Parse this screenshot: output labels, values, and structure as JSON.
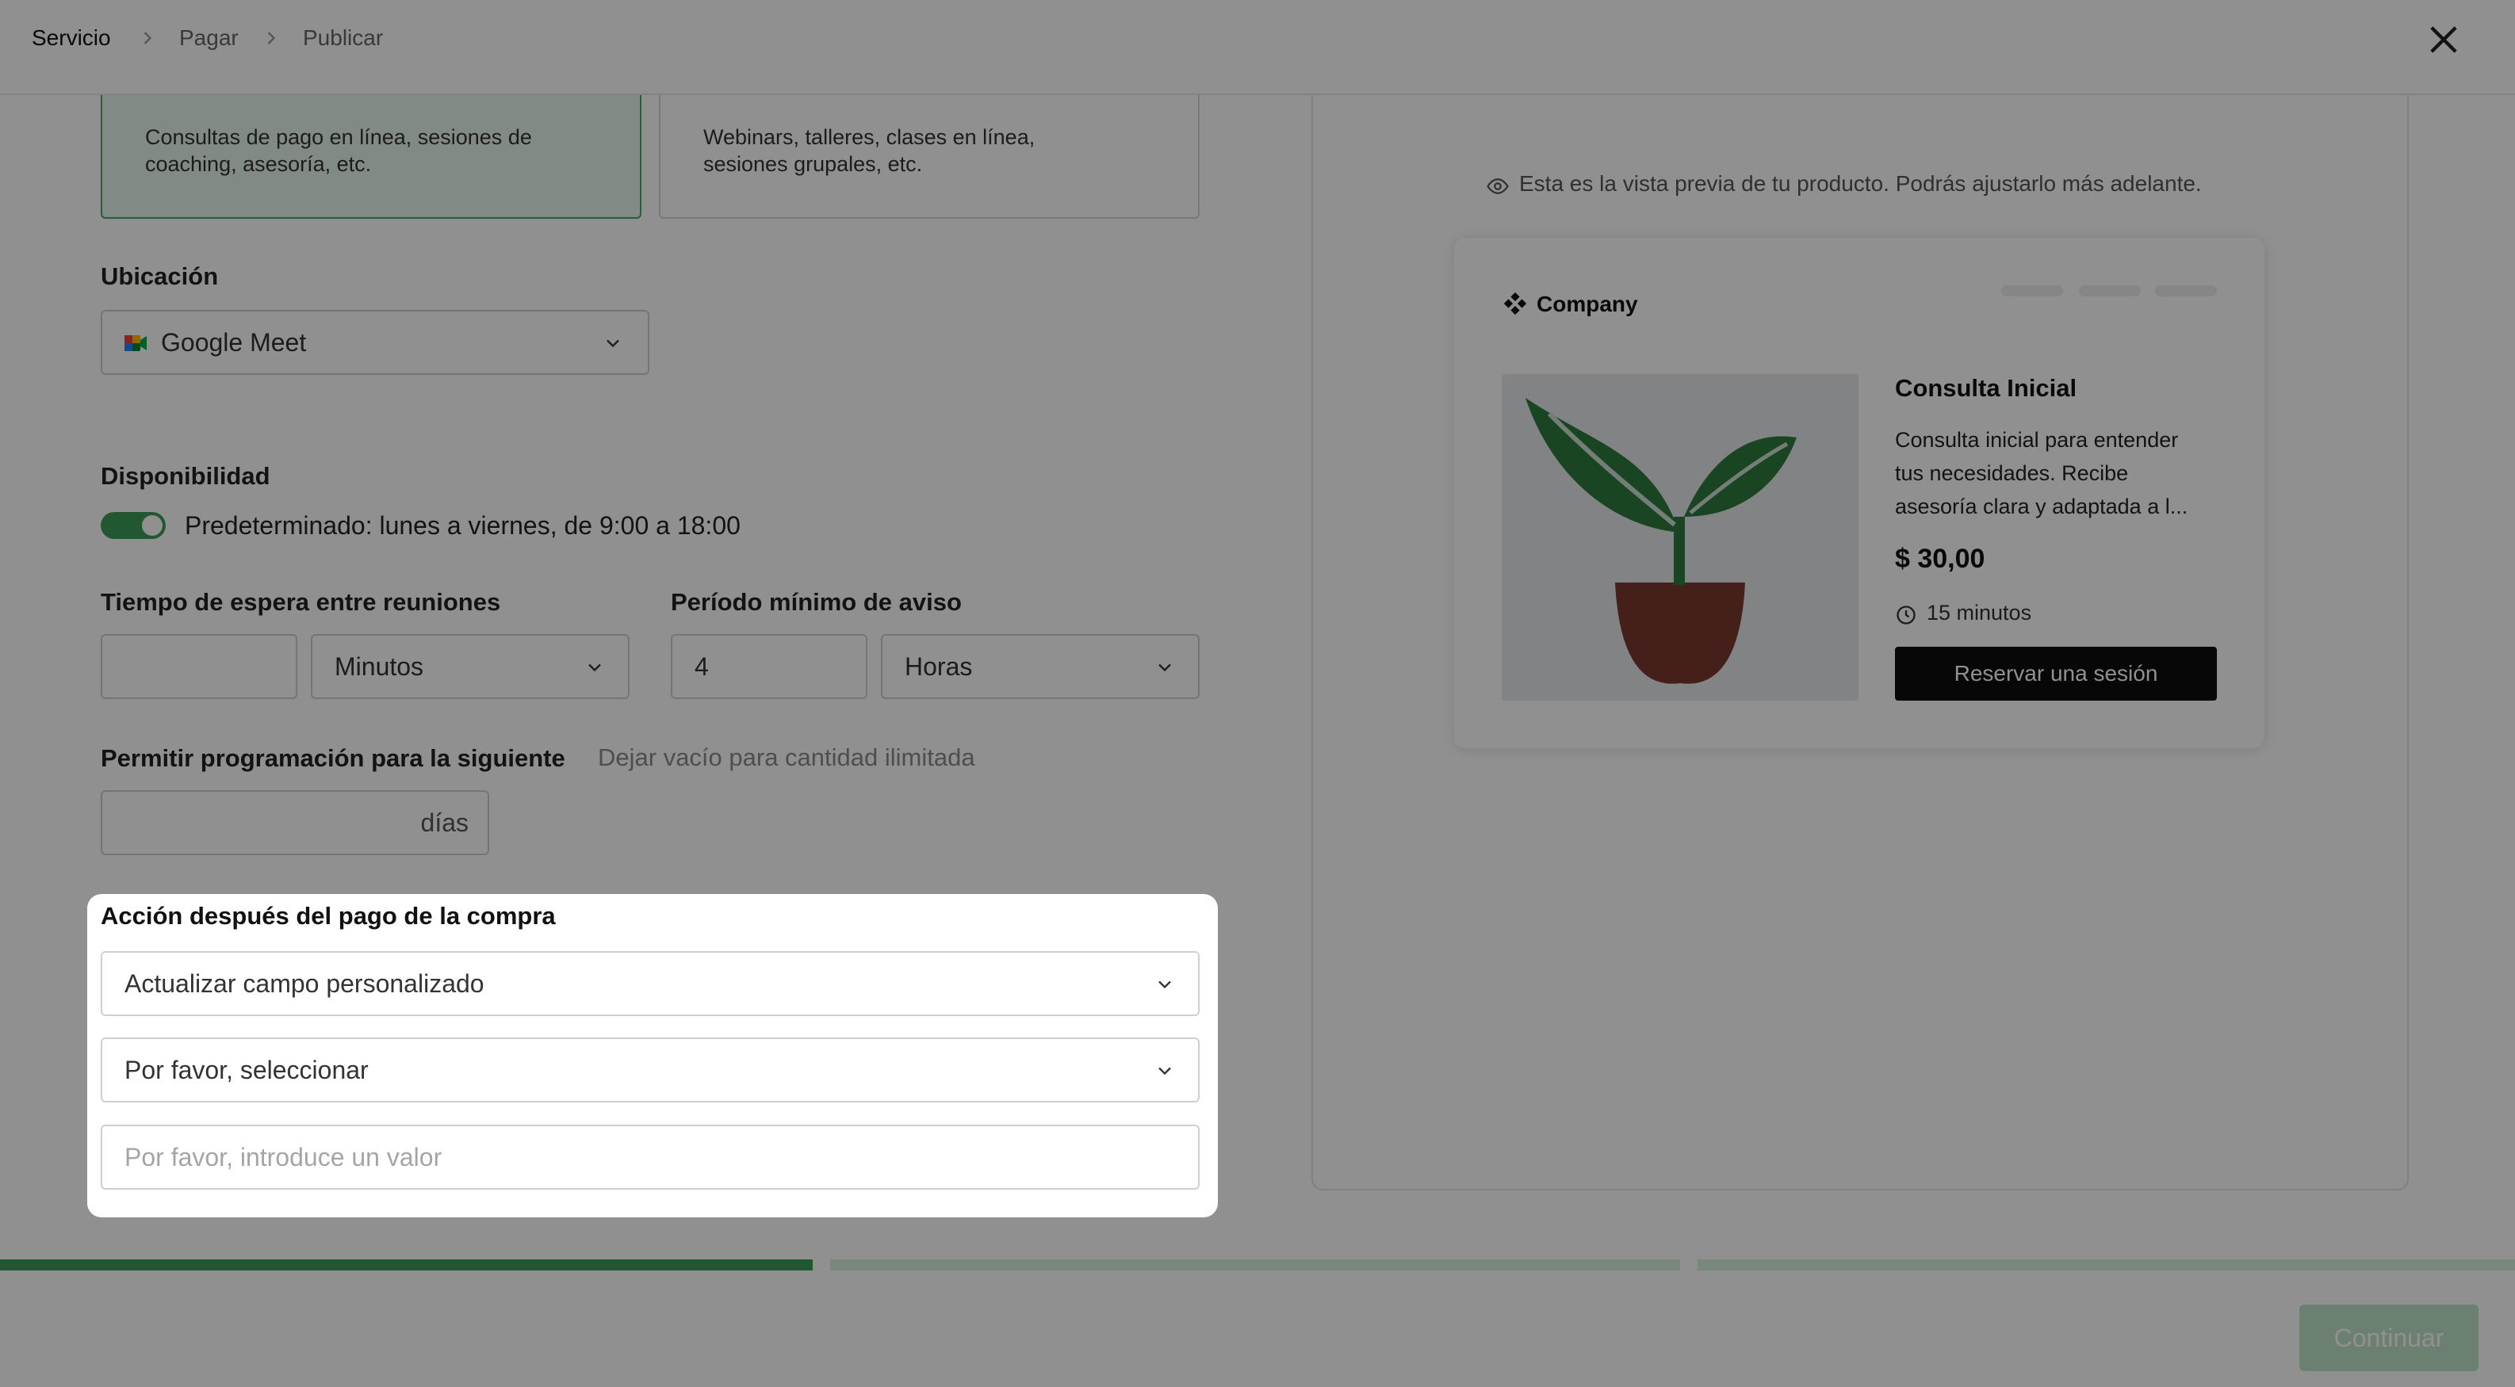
{
  "header": {
    "breadcrumb": [
      "Servicio",
      "Pagar",
      "Publicar"
    ],
    "close_icon": "close-icon"
  },
  "service_types": [
    {
      "description_line1": "Consultas de pago en línea, sesiones de",
      "description_line2": "coaching, asesoría, etc.",
      "selected": true
    },
    {
      "description_line1": "Webinars, talleres, clases en línea,",
      "description_line2": "sesiones grupales, etc.",
      "selected": false
    }
  ],
  "location": {
    "label": "Ubicación",
    "value": "Google Meet",
    "icon": "google-meet-icon"
  },
  "availability": {
    "label": "Disponibilidad",
    "toggle_on": true,
    "text": "Predeterminado: lunes a viernes, de 9:00 a 18:00"
  },
  "buffer": {
    "label": "Tiempo de espera entre reuniones",
    "value": "",
    "unit": "Minutos"
  },
  "notice": {
    "label": "Período mínimo de aviso",
    "value": "4",
    "unit": "Horas"
  },
  "scheduling": {
    "label": "Permitir programación para la siguiente",
    "hint": "Dejar vacío para cantidad ilimitada",
    "value": "",
    "suffix": "días"
  },
  "post_payment": {
    "label": "Acción después del pago de la compra",
    "action": "Actualizar campo personalizado",
    "field_select_placeholder": "Por favor, seleccionar",
    "value_placeholder": "Por favor, introduce un valor"
  },
  "preview": {
    "notice": "Esta es la vista previa de tu producto. Podrás ajustarlo más adelante.",
    "company": "Company",
    "product_title": "Consulta Inicial",
    "product_desc_line1": "Consulta inicial para entender",
    "product_desc_line2": "tus necesidades. Recibe",
    "product_desc_line3": "asesoría clara y adaptada a l...",
    "price": "$ 30,00",
    "duration": "15 minutos",
    "button": "Reservar una sesión"
  },
  "progress": {
    "step": 1,
    "total_steps": 3
  },
  "footer": {
    "continue_label": "Continuar"
  },
  "colors": {
    "accent": "#3c9a57",
    "overlay": "#000000",
    "continue_disabled": "#bfe3c8"
  }
}
